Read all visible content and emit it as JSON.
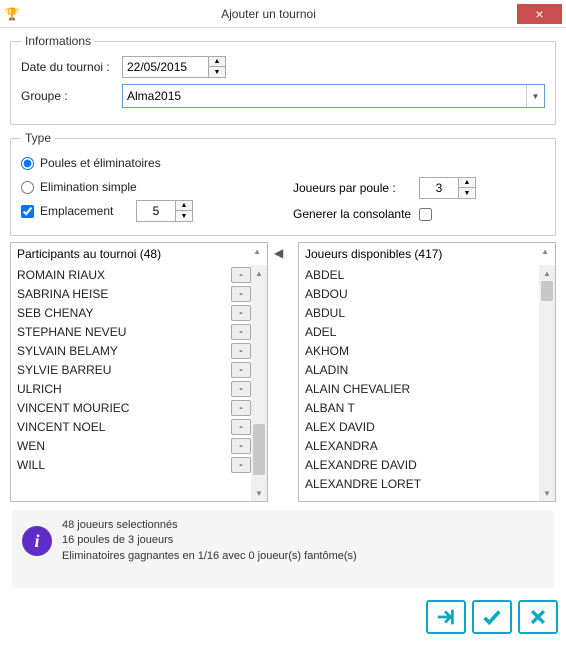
{
  "window": {
    "title": "Ajouter un tournoi"
  },
  "informations": {
    "legend": "Informations",
    "date_label": "Date du tournoi :",
    "date_value": "22/05/2015",
    "group_label": "Groupe :",
    "group_value": "Alma2015"
  },
  "type": {
    "legend": "Type",
    "radio_poules": "Poules et éliminatoires",
    "radio_elim": "Elimination simple",
    "check_emplacement": "Emplacement",
    "emplacement_value": "5",
    "players_per_pool_label": "Joueurs par poule :",
    "players_per_pool_value": "3",
    "generate_consolation_label": "Generer la consolante"
  },
  "participants": {
    "header": "Participants au tournoi (48)",
    "count": 48,
    "items": [
      "ROMAIN RIAUX",
      "SABRINA HEISE",
      "SEB CHENAY",
      "STEPHANE NEVEU",
      "SYLVAIN  BELAMY",
      "SYLVIE BARREU",
      "ULRICH",
      "VINCENT MOURIEC",
      "VINCENT NOEL",
      "WEN",
      "WILL"
    ]
  },
  "available": {
    "header": "Joueurs disponibles (417)",
    "count": 417,
    "items": [
      "ABDEL",
      "ABDOU",
      "ABDUL",
      "ADEL",
      "AKHOM",
      "ALADIN",
      "ALAIN CHEVALIER",
      "ALBAN T",
      "ALEX DAVID",
      "ALEXANDRA",
      "ALEXANDRE DAVID",
      "ALEXANDRE LORET"
    ]
  },
  "info": {
    "line1": "48 joueurs selectionnés",
    "line2": "16 poules de 3 joueurs",
    "line3": "Eliminatoires gagnantes en 1/16 avec 0 joueur(s) fantôme(s)"
  },
  "buttons": {
    "close": "×",
    "transfer_left": "◀",
    "remove": "-"
  }
}
